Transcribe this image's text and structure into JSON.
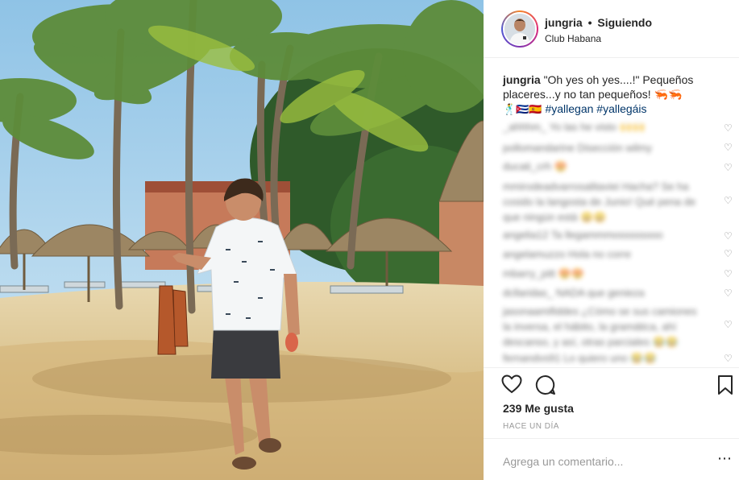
{
  "header": {
    "username": "jungria",
    "separator": "•",
    "follow_status": "Siguiendo",
    "location": "Club Habana"
  },
  "caption": {
    "username": "jungria",
    "text_1": "\"Oh yes oh yes....!\" Pequeños placeres...y no tan pequeños! 🦐🦐",
    "flags": "🕺🇨🇺🇪🇸",
    "hashtag_1": "#yallegan",
    "hashtag_2": "#yallegáis"
  },
  "comments": [
    {
      "text": "_ahhhm_ Yo las he visto 🙌🙌"
    },
    {
      "text": "pollomandarine Disección wilmy"
    },
    {
      "text": "ducati_crh 😍"
    },
    {
      "text": "mmirodeadvarrosalitaviei Hacha? Se ha cosido la langosta de Junio! Qué pena de que ningún está 😄😄"
    },
    {
      "text": "angelia12 Ta llegammmosssssooo"
    },
    {
      "text": "angelamuzzo Hola no corre"
    },
    {
      "text": "mbarry_pitt 😍😍"
    },
    {
      "text": "dcllaridas_ NADA que genieza"
    },
    {
      "text": "jasonaamifiddes ¿Cómo se sus camiones la inversa, el hábito, la gramática, ahí descanso, y así, otras parciales 😂😂"
    },
    {
      "text": "fernandvs91 Lo quiero uno 😂😂"
    }
  ],
  "stats": {
    "likes": "239 Me gusta",
    "time_ago": "HACE UN DÍA"
  },
  "add_comment": {
    "placeholder": "Agrega un comentario..."
  },
  "icons": {
    "like": "heart-icon",
    "comment": "comment-icon",
    "save": "bookmark-icon",
    "more": "more-options-icon"
  },
  "colors": {
    "hashtag": "#003569",
    "muted": "#999999",
    "avatar_ring": "#dd2a7b"
  }
}
